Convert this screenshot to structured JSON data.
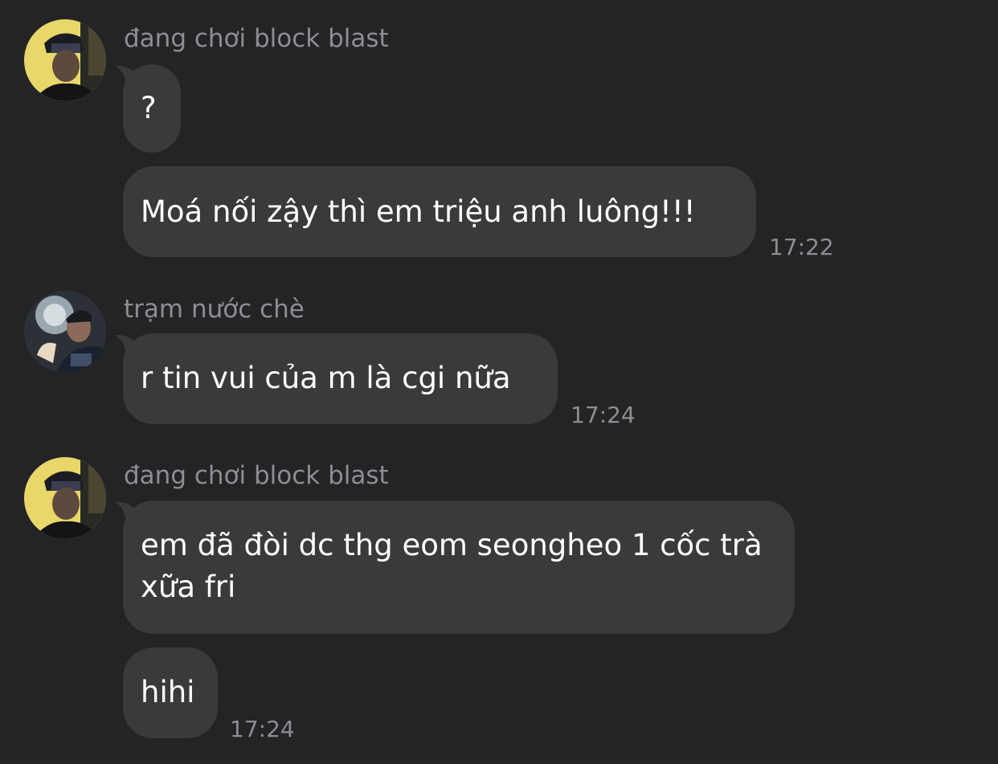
{
  "messages": [
    {
      "sender": "đang chơi block blast",
      "text": "?",
      "time": ""
    },
    {
      "sender": "",
      "text": "Moá nối zậy thì em triệu anh luông!!!",
      "time": "17:22"
    },
    {
      "sender": "trạm nước chè",
      "text": "r tin vui của m là cgi nữa",
      "time": "17:24"
    },
    {
      "sender": "đang chơi block blast",
      "text": "em đã đòi dc thg eom seongheo 1 cốc trà xữa fri",
      "time": ""
    },
    {
      "sender": "",
      "text": "hihi",
      "time": "17:24"
    }
  ]
}
